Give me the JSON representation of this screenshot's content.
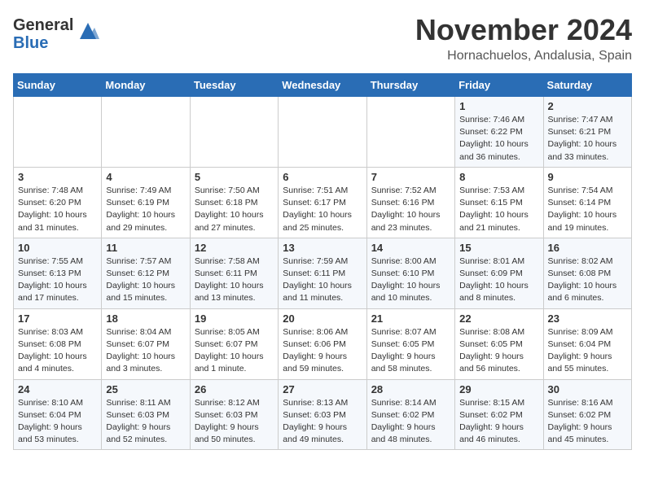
{
  "logo": {
    "general": "General",
    "blue": "Blue"
  },
  "title": "November 2024",
  "location": "Hornachuelos, Andalusia, Spain",
  "days_of_week": [
    "Sunday",
    "Monday",
    "Tuesday",
    "Wednesday",
    "Thursday",
    "Friday",
    "Saturday"
  ],
  "weeks": [
    [
      {
        "day": "",
        "info": ""
      },
      {
        "day": "",
        "info": ""
      },
      {
        "day": "",
        "info": ""
      },
      {
        "day": "",
        "info": ""
      },
      {
        "day": "",
        "info": ""
      },
      {
        "day": "1",
        "info": "Sunrise: 7:46 AM\nSunset: 6:22 PM\nDaylight: 10 hours and 36 minutes."
      },
      {
        "day": "2",
        "info": "Sunrise: 7:47 AM\nSunset: 6:21 PM\nDaylight: 10 hours and 33 minutes."
      }
    ],
    [
      {
        "day": "3",
        "info": "Sunrise: 7:48 AM\nSunset: 6:20 PM\nDaylight: 10 hours and 31 minutes."
      },
      {
        "day": "4",
        "info": "Sunrise: 7:49 AM\nSunset: 6:19 PM\nDaylight: 10 hours and 29 minutes."
      },
      {
        "day": "5",
        "info": "Sunrise: 7:50 AM\nSunset: 6:18 PM\nDaylight: 10 hours and 27 minutes."
      },
      {
        "day": "6",
        "info": "Sunrise: 7:51 AM\nSunset: 6:17 PM\nDaylight: 10 hours and 25 minutes."
      },
      {
        "day": "7",
        "info": "Sunrise: 7:52 AM\nSunset: 6:16 PM\nDaylight: 10 hours and 23 minutes."
      },
      {
        "day": "8",
        "info": "Sunrise: 7:53 AM\nSunset: 6:15 PM\nDaylight: 10 hours and 21 minutes."
      },
      {
        "day": "9",
        "info": "Sunrise: 7:54 AM\nSunset: 6:14 PM\nDaylight: 10 hours and 19 minutes."
      }
    ],
    [
      {
        "day": "10",
        "info": "Sunrise: 7:55 AM\nSunset: 6:13 PM\nDaylight: 10 hours and 17 minutes."
      },
      {
        "day": "11",
        "info": "Sunrise: 7:57 AM\nSunset: 6:12 PM\nDaylight: 10 hours and 15 minutes."
      },
      {
        "day": "12",
        "info": "Sunrise: 7:58 AM\nSunset: 6:11 PM\nDaylight: 10 hours and 13 minutes."
      },
      {
        "day": "13",
        "info": "Sunrise: 7:59 AM\nSunset: 6:11 PM\nDaylight: 10 hours and 11 minutes."
      },
      {
        "day": "14",
        "info": "Sunrise: 8:00 AM\nSunset: 6:10 PM\nDaylight: 10 hours and 10 minutes."
      },
      {
        "day": "15",
        "info": "Sunrise: 8:01 AM\nSunset: 6:09 PM\nDaylight: 10 hours and 8 minutes."
      },
      {
        "day": "16",
        "info": "Sunrise: 8:02 AM\nSunset: 6:08 PM\nDaylight: 10 hours and 6 minutes."
      }
    ],
    [
      {
        "day": "17",
        "info": "Sunrise: 8:03 AM\nSunset: 6:08 PM\nDaylight: 10 hours and 4 minutes."
      },
      {
        "day": "18",
        "info": "Sunrise: 8:04 AM\nSunset: 6:07 PM\nDaylight: 10 hours and 3 minutes."
      },
      {
        "day": "19",
        "info": "Sunrise: 8:05 AM\nSunset: 6:07 PM\nDaylight: 10 hours and 1 minute."
      },
      {
        "day": "20",
        "info": "Sunrise: 8:06 AM\nSunset: 6:06 PM\nDaylight: 9 hours and 59 minutes."
      },
      {
        "day": "21",
        "info": "Sunrise: 8:07 AM\nSunset: 6:05 PM\nDaylight: 9 hours and 58 minutes."
      },
      {
        "day": "22",
        "info": "Sunrise: 8:08 AM\nSunset: 6:05 PM\nDaylight: 9 hours and 56 minutes."
      },
      {
        "day": "23",
        "info": "Sunrise: 8:09 AM\nSunset: 6:04 PM\nDaylight: 9 hours and 55 minutes."
      }
    ],
    [
      {
        "day": "24",
        "info": "Sunrise: 8:10 AM\nSunset: 6:04 PM\nDaylight: 9 hours and 53 minutes."
      },
      {
        "day": "25",
        "info": "Sunrise: 8:11 AM\nSunset: 6:03 PM\nDaylight: 9 hours and 52 minutes."
      },
      {
        "day": "26",
        "info": "Sunrise: 8:12 AM\nSunset: 6:03 PM\nDaylight: 9 hours and 50 minutes."
      },
      {
        "day": "27",
        "info": "Sunrise: 8:13 AM\nSunset: 6:03 PM\nDaylight: 9 hours and 49 minutes."
      },
      {
        "day": "28",
        "info": "Sunrise: 8:14 AM\nSunset: 6:02 PM\nDaylight: 9 hours and 48 minutes."
      },
      {
        "day": "29",
        "info": "Sunrise: 8:15 AM\nSunset: 6:02 PM\nDaylight: 9 hours and 46 minutes."
      },
      {
        "day": "30",
        "info": "Sunrise: 8:16 AM\nSunset: 6:02 PM\nDaylight: 9 hours and 45 minutes."
      }
    ]
  ]
}
